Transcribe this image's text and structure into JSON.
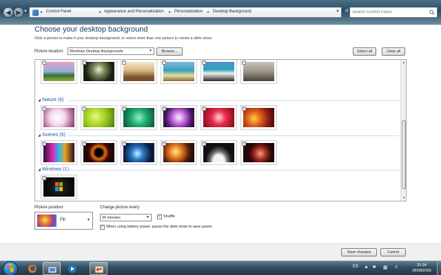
{
  "address": {
    "crumbs": [
      "Control Panel",
      "Appearance and Personalization",
      "Personalization",
      "Desktop Background"
    ],
    "search_placeholder": "Search Control Panel"
  },
  "page": {
    "title": "Choose your desktop background",
    "instructions": "Click a picture to make it your desktop background, or select more than one picture to create a slide show."
  },
  "location": {
    "label": "Picture location:",
    "value": "Windows Desktop Backgrounds",
    "browse": "Browse...",
    "select_all": "Select all",
    "clear_all": "Clear all"
  },
  "gallery": {
    "groups": [
      {
        "label": "",
        "thumbs": [
          {
            "icon": "wallpaper-landscape-pink-sky",
            "checked": true
          },
          {
            "icon": "wallpaper-tree-dark",
            "checked": true
          },
          {
            "icon": "wallpaper-desert-rocks",
            "checked": true
          },
          {
            "icon": "wallpaper-beach-lagoon",
            "checked": true
          },
          {
            "icon": "wallpaper-coast-turquoise",
            "checked": true
          },
          {
            "icon": "wallpaper-shore-mist",
            "checked": true
          }
        ]
      },
      {
        "label": "Nature (6)",
        "thumbs": [
          {
            "icon": "wallpaper-white-flower",
            "checked": true
          },
          {
            "icon": "wallpaper-green-bubbles",
            "checked": true
          },
          {
            "icon": "wallpaper-green-leaves",
            "checked": true
          },
          {
            "icon": "wallpaper-purple-flower",
            "checked": true
          },
          {
            "icon": "wallpaper-red-petals",
            "checked": true
          },
          {
            "icon": "wallpaper-autumn-lights",
            "checked": true
          }
        ]
      },
      {
        "label": "Scenes (6)",
        "thumbs": [
          {
            "icon": "wallpaper-neon-tunnel",
            "checked": true
          },
          {
            "icon": "wallpaper-fire-ring",
            "checked": true
          },
          {
            "icon": "wallpaper-blue-nebula",
            "checked": true
          },
          {
            "icon": "wallpaper-orange-flare",
            "checked": true
          },
          {
            "icon": "wallpaper-planet-rise",
            "checked": true
          },
          {
            "icon": "wallpaper-red-planet",
            "checked": true
          }
        ]
      },
      {
        "label": "Windows (1)",
        "thumbs": [
          {
            "icon": "wallpaper-windows-logo",
            "checked": true
          }
        ]
      }
    ]
  },
  "position": {
    "label": "Picture position:",
    "value": "Fill"
  },
  "change": {
    "label": "Change picture every:",
    "value": "30 minutes",
    "shuffle_label": "Shuffle",
    "shuffle_checked": true,
    "battery_label": "When using battery power, pause the slide show to save power",
    "battery_checked": true
  },
  "footer": {
    "save": "Save changes",
    "cancel": "Cancel"
  },
  "taskbar": {
    "lang": "ES",
    "time": "22:34",
    "date": "28/08/2009"
  }
}
